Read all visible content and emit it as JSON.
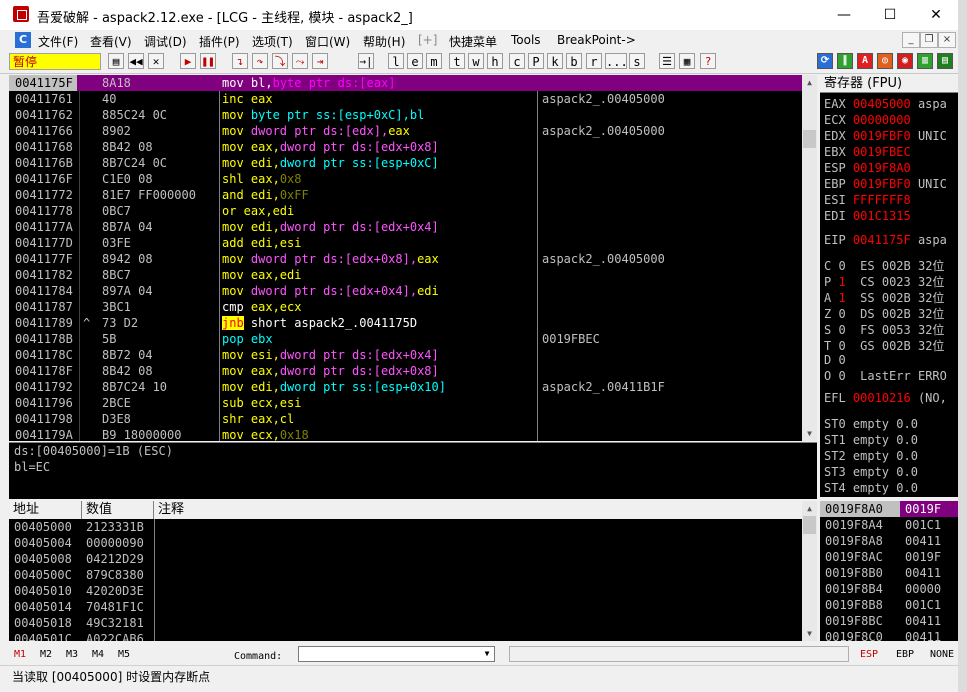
{
  "window": {
    "title": "吾爱破解 - aspack2.12.exe - [LCG - 主线程, 模块 - aspack2_]",
    "minimize": "—",
    "maximize": "☐",
    "close": "✕"
  },
  "menu": {
    "items": [
      "文件(F)",
      "查看(V)",
      "调试(D)",
      "插件(P)",
      "选项(T)",
      "窗口(W)",
      "帮助(H)",
      "[+]",
      "快捷菜单",
      "Tools",
      "BreakPoint->"
    ],
    "mdi": [
      "_",
      "❐",
      "×"
    ]
  },
  "toolbar": {
    "status": "暂停",
    "buttons": [
      "open-icon",
      "rewind-icon",
      "close-icon",
      "run-icon",
      "pause-icon",
      "step-into-icon",
      "step-over-icon",
      "trace-into-icon",
      "trace-over-icon",
      "exec-till-return-icon",
      "goto-icon"
    ],
    "letters": [
      "l",
      "e",
      "m",
      "t",
      "w",
      "h",
      "c",
      "P",
      "k",
      "b",
      "r",
      "...",
      "s"
    ]
  },
  "disasm": {
    "rows": [
      {
        "addr": "0041175F",
        "mark": "",
        "hex": "8A18",
        "asm": [
          [
            "mov",
            "w"
          ],
          [
            " bl,",
            "w"
          ],
          [
            "byte ptr ds:[eax]",
            "r"
          ]
        ],
        "cmt": "",
        "sel": true
      },
      {
        "addr": "00411761",
        "mark": "",
        "hex": "40",
        "asm": [
          [
            "inc",
            "y"
          ],
          [
            " eax",
            "y"
          ]
        ],
        "cmt": "aspack2_.00405000"
      },
      {
        "addr": "00411762",
        "mark": "",
        "hex": "885C24 0C",
        "asm": [
          [
            "mov",
            "y"
          ],
          [
            " byte ptr ss:[esp+0xC],bl",
            "c"
          ]
        ],
        "cmt": ""
      },
      {
        "addr": "00411766",
        "mark": "",
        "hex": "8902",
        "asm": [
          [
            "mov",
            "y"
          ],
          [
            " dword ptr ds:[edx],",
            "m"
          ],
          [
            "eax",
            "y"
          ]
        ],
        "cmt": "aspack2_.00405000"
      },
      {
        "addr": "00411768",
        "mark": "",
        "hex": "8B42 08",
        "asm": [
          [
            "mov",
            "y"
          ],
          [
            " eax,",
            "y"
          ],
          [
            "dword ptr ds:[edx+0x8]",
            "m"
          ]
        ],
        "cmt": ""
      },
      {
        "addr": "0041176B",
        "mark": "",
        "hex": "8B7C24 0C",
        "asm": [
          [
            "mov",
            "y"
          ],
          [
            " edi,",
            "y"
          ],
          [
            "dword ptr ss:[esp+0xC]",
            "c"
          ]
        ],
        "cmt": ""
      },
      {
        "addr": "0041176F",
        "mark": "",
        "hex": "C1E0 08",
        "asm": [
          [
            "shl",
            "y"
          ],
          [
            " eax,",
            "y"
          ],
          [
            "0x8",
            "o"
          ]
        ],
        "cmt": ""
      },
      {
        "addr": "00411772",
        "mark": "",
        "hex": "81E7 FF000000",
        "asm": [
          [
            "and",
            "y"
          ],
          [
            " edi,",
            "y"
          ],
          [
            "0xFF",
            "o"
          ]
        ],
        "cmt": ""
      },
      {
        "addr": "00411778",
        "mark": "",
        "hex": "0BC7",
        "asm": [
          [
            "or",
            "y"
          ],
          [
            " eax,edi",
            "y"
          ]
        ],
        "cmt": ""
      },
      {
        "addr": "0041177A",
        "mark": "",
        "hex": "8B7A 04",
        "asm": [
          [
            "mov",
            "y"
          ],
          [
            " edi,",
            "y"
          ],
          [
            "dword ptr ds:[edx+0x4]",
            "m"
          ]
        ],
        "cmt": ""
      },
      {
        "addr": "0041177D",
        "mark": "",
        "hex": "03FE",
        "asm": [
          [
            "add",
            "y"
          ],
          [
            " edi,esi",
            "y"
          ]
        ],
        "cmt": ""
      },
      {
        "addr": "0041177F",
        "mark": "",
        "hex": "8942 08",
        "asm": [
          [
            "mov",
            "y"
          ],
          [
            " dword ptr ds:[edx+0x8],",
            "m"
          ],
          [
            "eax",
            "y"
          ]
        ],
        "cmt": "aspack2_.00405000"
      },
      {
        "addr": "00411782",
        "mark": "",
        "hex": "8BC7",
        "asm": [
          [
            "mov",
            "y"
          ],
          [
            " eax,edi",
            "y"
          ]
        ],
        "cmt": ""
      },
      {
        "addr": "00411784",
        "mark": "",
        "hex": "897A 04",
        "asm": [
          [
            "mov",
            "y"
          ],
          [
            " dword ptr ds:[edx+0x4],",
            "m"
          ],
          [
            "edi",
            "y"
          ]
        ],
        "cmt": ""
      },
      {
        "addr": "00411787",
        "mark": "",
        "hex": "3BC1",
        "asm": [
          [
            "cmp",
            "w"
          ],
          [
            " eax,ecx",
            "y"
          ]
        ],
        "cmt": ""
      },
      {
        "addr": "00411789",
        "mark": "^",
        "hex": "73 D2",
        "asm": [
          [
            "jnb",
            "j"
          ],
          [
            " short aspack2_.0041175D",
            "w"
          ]
        ],
        "cmt": ""
      },
      {
        "addr": "0041178B",
        "mark": "",
        "hex": "5B",
        "asm": [
          [
            "pop",
            "b"
          ],
          [
            " ebx",
            "b"
          ]
        ],
        "cmt": "0019FBEC"
      },
      {
        "addr": "0041178C",
        "mark": "",
        "hex": "8B72 04",
        "asm": [
          [
            "mov",
            "y"
          ],
          [
            " esi,",
            "y"
          ],
          [
            "dword ptr ds:[edx+0x4]",
            "m"
          ]
        ],
        "cmt": ""
      },
      {
        "addr": "0041178F",
        "mark": "",
        "hex": "8B42 08",
        "asm": [
          [
            "mov",
            "y"
          ],
          [
            " eax,",
            "y"
          ],
          [
            "dword ptr ds:[edx+0x8]",
            "m"
          ]
        ],
        "cmt": ""
      },
      {
        "addr": "00411792",
        "mark": "",
        "hex": "8B7C24 10",
        "asm": [
          [
            "mov",
            "y"
          ],
          [
            " edi,",
            "y"
          ],
          [
            "dword ptr ss:[esp+0x10]",
            "c"
          ]
        ],
        "cmt": "aspack2_.00411B1F"
      },
      {
        "addr": "00411796",
        "mark": "",
        "hex": "2BCE",
        "asm": [
          [
            "sub",
            "y"
          ],
          [
            " ecx,esi",
            "y"
          ]
        ],
        "cmt": ""
      },
      {
        "addr": "00411798",
        "mark": "",
        "hex": "D3E8",
        "asm": [
          [
            "shr",
            "y"
          ],
          [
            " eax,cl",
            "y"
          ]
        ],
        "cmt": ""
      },
      {
        "addr": "0041179A",
        "mark": "",
        "hex": "B9 18000000",
        "asm": [
          [
            "mov",
            "y"
          ],
          [
            " ecx,",
            "y"
          ],
          [
            "0x18",
            "o"
          ]
        ],
        "cmt": ""
      }
    ]
  },
  "info": {
    "line1": "ds:[00405000]=1B (ESC)",
    "line2": "bl=EC"
  },
  "registers": {
    "header": "寄存器 (FPU)",
    "general": [
      {
        "name": "EAX",
        "value": "00405000",
        "extra": "aspa"
      },
      {
        "name": "ECX",
        "value": "00000000",
        "extra": ""
      },
      {
        "name": "EDX",
        "value": "0019FBF0",
        "extra": "UNIC"
      },
      {
        "name": "EBX",
        "value": "0019FBEC",
        "extra": ""
      },
      {
        "name": "ESP",
        "value": "0019F8A0",
        "extra": ""
      },
      {
        "name": "EBP",
        "value": "0019FBF0",
        "extra": "UNIC"
      },
      {
        "name": "ESI",
        "value": "FFFFFFF8",
        "extra": ""
      },
      {
        "name": "EDI",
        "value": "001C1315",
        "extra": ""
      }
    ],
    "eip": {
      "name": "EIP",
      "value": "0041175F",
      "extra": "aspa"
    },
    "flags": [
      {
        "f": "C",
        "v": "0",
        "seg": "ES",
        "sv": "002B",
        "bits": "32位"
      },
      {
        "f": "P",
        "v": "1",
        "seg": "CS",
        "sv": "0023",
        "bits": "32位"
      },
      {
        "f": "A",
        "v": "1",
        "seg": "SS",
        "sv": "002B",
        "bits": "32位"
      },
      {
        "f": "Z",
        "v": "0",
        "seg": "DS",
        "sv": "002B",
        "bits": "32位"
      },
      {
        "f": "S",
        "v": "0",
        "seg": "FS",
        "sv": "0053",
        "bits": "32位"
      },
      {
        "f": "T",
        "v": "0",
        "seg": "GS",
        "sv": "002B",
        "bits": "32位"
      },
      {
        "f": "D",
        "v": "0",
        "seg": "",
        "sv": "",
        "bits": ""
      },
      {
        "f": "O",
        "v": "0",
        "seg": "LastErr",
        "sv": "ERRO",
        "bits": ""
      }
    ],
    "efl": {
      "name": "EFL",
      "value": "00010216",
      "extra": "(NO,"
    },
    "fpu": [
      "ST0 empty 0.0",
      "ST1 empty 0.0",
      "ST2 empty 0.0",
      "ST3 empty 0.0",
      "ST4 empty 0.0"
    ]
  },
  "dump": {
    "headers": [
      "地址",
      "数值",
      "注释"
    ],
    "rows": [
      {
        "addr": "00405000",
        "val": "2123331B"
      },
      {
        "addr": "00405004",
        "val": "00000090"
      },
      {
        "addr": "00405008",
        "val": "04212D29"
      },
      {
        "addr": "0040500C",
        "val": "879C8380"
      },
      {
        "addr": "00405010",
        "val": "42020D3E"
      },
      {
        "addr": "00405014",
        "val": "70481F1C"
      },
      {
        "addr": "00405018",
        "val": "49C32181"
      },
      {
        "addr": "0040501C",
        "val": "A022CAB6"
      }
    ]
  },
  "stack": {
    "rows": [
      {
        "addr": "0019F8A0",
        "val": "0019F",
        "sel": true
      },
      {
        "addr": "0019F8A4",
        "val": "001C1"
      },
      {
        "addr": "0019F8A8",
        "val": "00411"
      },
      {
        "addr": "0019F8AC",
        "val": "0019F"
      },
      {
        "addr": "0019F8B0",
        "val": "00411"
      },
      {
        "addr": "0019F8B4",
        "val": "00000"
      },
      {
        "addr": "0019F8B8",
        "val": "001C1"
      },
      {
        "addr": "0019F8BC",
        "val": "00411"
      },
      {
        "addr": "0019F8C0",
        "val": "00411"
      }
    ]
  },
  "cmdbar": {
    "marks": [
      "M1",
      "M2",
      "M3",
      "M4",
      "M5"
    ],
    "command_label": "Command:",
    "command_value": "",
    "regs": [
      "ESP",
      "EBP",
      "NONE"
    ]
  },
  "status": {
    "text": "当读取 [00405000] 时设置内存断点"
  },
  "colors": {
    "y": "#ffff00",
    "w": "#ffffff",
    "r": "#ff00ff",
    "c": "#00ffff",
    "m": "#ff55ff",
    "o": "#808000",
    "j": "#ff0000",
    "b": "#00ffff",
    "reg_red": "#ff0000",
    "sel": "#800080"
  }
}
